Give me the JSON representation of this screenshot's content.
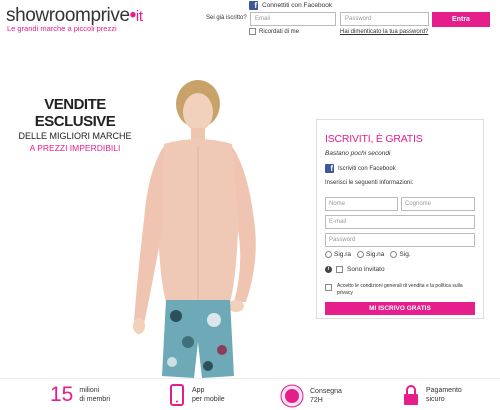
{
  "header": {
    "logo_main": "showroomprive",
    "logo_dot": "•",
    "logo_tld": "it",
    "tagline": "Le grandi marche a piccoli prezzi",
    "facebook_connect": "Connettiti con Facebook",
    "already_registered": "Sei già iscritto?",
    "email_placeholder": "Email",
    "password_placeholder": "Password",
    "login_button": "Entra",
    "remember_me": "Ricordati di me",
    "forgot_password": "Hai dimenticato la tua password?"
  },
  "hero": {
    "headline": "VENDITE ESCLUSIVE",
    "subheadline": "DELLE MIGLIORI MARCHE",
    "pink_line": "A PREZZI IMPERDIBILI"
  },
  "signup": {
    "title": "ISCRIVITI, È GRATIS",
    "subtitle": "Bastano pochi secondi",
    "facebook": "Iscriviti con Facebook",
    "instructions": "Inserisci le seguenti informazioni:",
    "nome_placeholder": "Nome",
    "cognome_placeholder": "Cognome",
    "email_placeholder": "E-mail",
    "password_placeholder": "Password",
    "title_options": [
      "Sig.ra",
      "Sig.na",
      "Sig."
    ],
    "invited": "Sono invitato",
    "conditions": "Accetto le condizioni generali di vendita e la politica sulla privacy",
    "submit": "MI ISCRIVO GRATIS"
  },
  "footer": {
    "members_number": "15",
    "members_line1": "milioni",
    "members_line2": "di membri",
    "app_line1": "App",
    "app_line2": "per mobile",
    "delivery_badge": "CONSEGNA IN 72H",
    "delivery_line1": "Consegna",
    "delivery_line2": "72H",
    "payment_line1": "Pagamento",
    "payment_line2": "sicuro"
  },
  "colors": {
    "accent": "#e51e8c",
    "facebook": "#3b5998"
  },
  "icons": [
    "facebook-icon",
    "info-icon",
    "mobile-phone-icon",
    "delivery-badge-icon",
    "padlock-icon"
  ]
}
